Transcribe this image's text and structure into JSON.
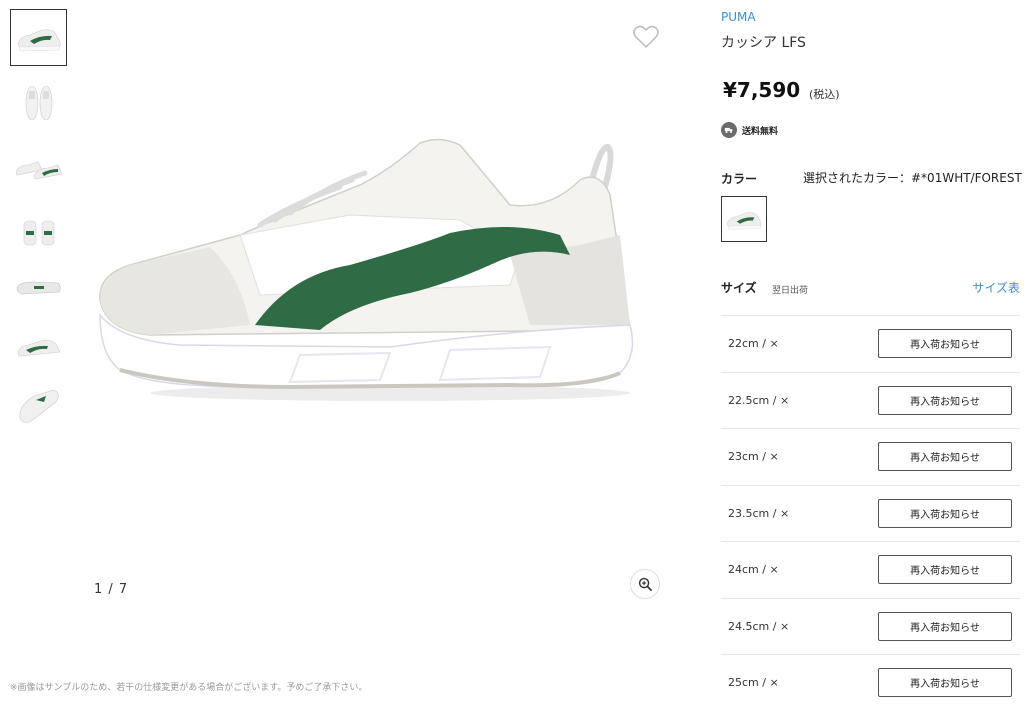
{
  "gallery": {
    "counter": "1 / 7",
    "thumbnails": [
      "side-view",
      "top-view",
      "pair-view",
      "back-view",
      "sole-view",
      "rear-angle-view",
      "top-down-view"
    ]
  },
  "product": {
    "brand": "PUMA",
    "name": "カッシア LFS",
    "price": "¥7,590",
    "tax_note": "(税込)",
    "shipping": "送料無料"
  },
  "color": {
    "label": "カラー",
    "selected_text": "選択されたカラー：#*01WHT/FOREST"
  },
  "size": {
    "label": "サイズ",
    "sublabel": "翌日出荷",
    "guide_link": "サイズ表",
    "rows": [
      {
        "size": "22cm / ×",
        "button": "再入荷お知らせ"
      },
      {
        "size": "22.5cm / ×",
        "button": "再入荷お知らせ"
      },
      {
        "size": "23cm / ×",
        "button": "再入荷お知らせ"
      },
      {
        "size": "23.5cm / ×",
        "button": "再入荷お知らせ"
      },
      {
        "size": "24cm / ×",
        "button": "再入荷お知らせ"
      },
      {
        "size": "24.5cm / ×",
        "button": "再入荷お知らせ"
      },
      {
        "size": "25cm / ×",
        "button": "再入荷お知らせ"
      }
    ]
  },
  "footnote": "※画像はサンプルのため、若干の仕様変更がある場合がございます。予めご了承下さい。",
  "colors": {
    "accent": "#3a8fd3",
    "shoe_green": "#2f6b45",
    "border": "#333333"
  }
}
